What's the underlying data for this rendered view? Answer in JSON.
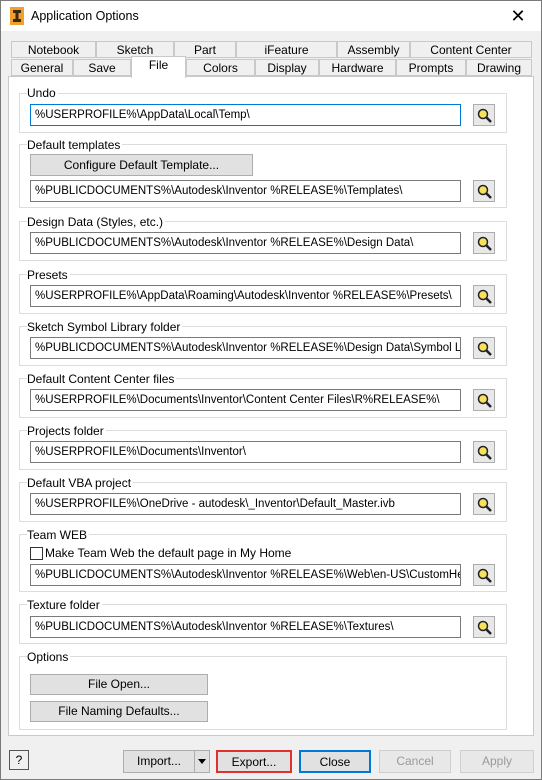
{
  "window": {
    "title": "Application Options"
  },
  "tabs": {
    "row1": [
      "Notebook",
      "Sketch",
      "Part",
      "iFeature",
      "Assembly",
      "Content Center"
    ],
    "row2": [
      "General",
      "Save",
      "File",
      "Colors",
      "Display",
      "Hardware",
      "Prompts",
      "Drawing"
    ],
    "active": "File"
  },
  "undo": {
    "label": "Undo",
    "path": "%USERPROFILE%\\AppData\\Local\\Temp\\"
  },
  "default_templates": {
    "label": "Default templates",
    "configure_button": "Configure Default Template...",
    "path": "%PUBLICDOCUMENTS%\\Autodesk\\Inventor %RELEASE%\\Templates\\"
  },
  "design_data": {
    "label": "Design Data (Styles, etc.)",
    "path": "%PUBLICDOCUMENTS%\\Autodesk\\Inventor %RELEASE%\\Design Data\\"
  },
  "presets": {
    "label": "Presets",
    "path": "%USERPROFILE%\\AppData\\Roaming\\Autodesk\\Inventor %RELEASE%\\Presets\\"
  },
  "sketch_symbol": {
    "label": "Sketch Symbol Library folder",
    "path": "%PUBLICDOCUMENTS%\\Autodesk\\Inventor %RELEASE%\\Design Data\\Symbol Library\\"
  },
  "content_center": {
    "label": "Default Content Center files",
    "path": "%USERPROFILE%\\Documents\\Inventor\\Content Center Files\\R%RELEASE%\\"
  },
  "projects": {
    "label": "Projects folder",
    "path": "%USERPROFILE%\\Documents\\Inventor\\"
  },
  "vba": {
    "label": "Default VBA project",
    "path": "%USERPROFILE%\\OneDrive - autodesk\\_Inventor\\Default_Master.ivb"
  },
  "team_web": {
    "label": "Team WEB",
    "checkbox_label": "Make Team Web the default page in My Home",
    "checked": false,
    "path": "%PUBLICDOCUMENTS%\\Autodesk\\Inventor %RELEASE%\\Web\\en-US\\CustomHelpSample\\"
  },
  "texture": {
    "label": "Texture folder",
    "path": "%PUBLICDOCUMENTS%\\Autodesk\\Inventor %RELEASE%\\Textures\\"
  },
  "options": {
    "label": "Options",
    "file_open": "File Open...",
    "file_naming": "File Naming Defaults..."
  },
  "footer": {
    "help": "?",
    "import": "Import...",
    "export": "Export...",
    "close": "Close",
    "cancel": "Cancel",
    "apply": "Apply"
  },
  "colors": {
    "focus": "#0078d7",
    "export_highlight": "#e03030",
    "disabled_text": "#9a9a9a"
  }
}
